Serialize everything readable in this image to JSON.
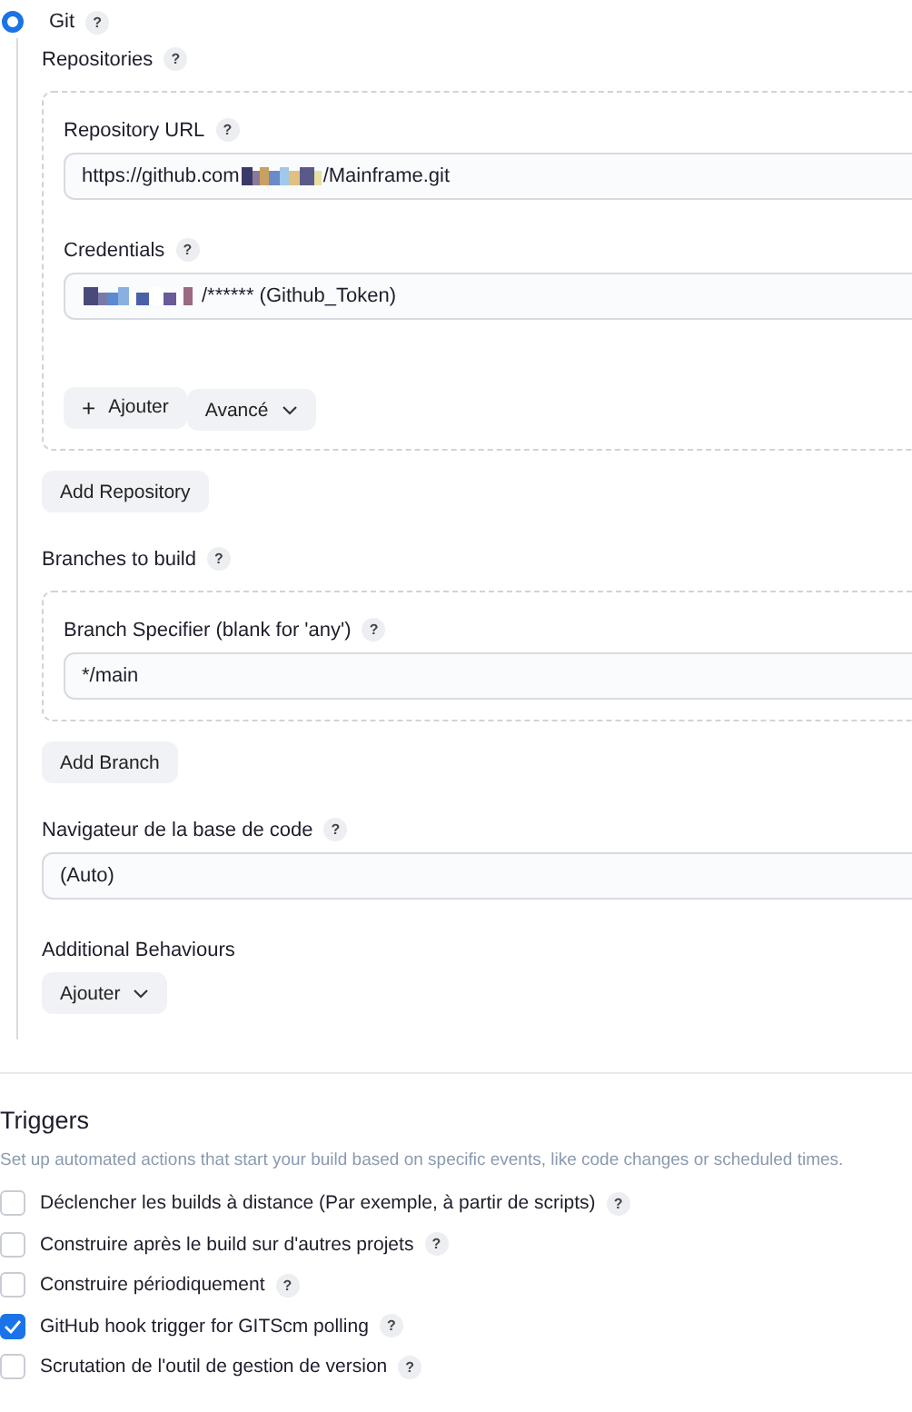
{
  "scm": {
    "label": "Git",
    "selected": true,
    "help": "?"
  },
  "repositories": {
    "label": "Repositories",
    "help": "?",
    "url": {
      "label": "Repository URL",
      "help": "?",
      "value_start": "https://github.com",
      "value_end": "/Mainframe.git"
    },
    "credentials": {
      "label": "Credentials",
      "help": "?",
      "value_end": "/****** (Github_Token)"
    },
    "add_credentials": {
      "icon": "+",
      "label": "Ajouter"
    },
    "advanced": {
      "label": "Avancé"
    },
    "add_button": "Add Repository"
  },
  "branches": {
    "label": "Branches to build",
    "help": "?",
    "specifier": {
      "label": "Branch Specifier (blank for 'any')",
      "help": "?",
      "value": "*/main"
    },
    "add_button": "Add Branch"
  },
  "browser": {
    "label": "Navigateur de la base de code",
    "help": "?",
    "value": "(Auto)"
  },
  "behaviours": {
    "label": "Additional Behaviours",
    "add_button": "Ajouter"
  },
  "triggers": {
    "title": "Triggers",
    "description": "Set up automated actions that start your build based on specific events, like code changes or scheduled times.",
    "items": [
      {
        "label": "Déclencher les builds à distance (Par exemple, à partir de scripts)",
        "checked": false,
        "help": "?"
      },
      {
        "label": "Construire après le build sur d'autres projets",
        "checked": false,
        "help": "?"
      },
      {
        "label": "Construire périodiquement",
        "checked": false,
        "help": "?"
      },
      {
        "label": "GitHub hook trigger for GITScm polling",
        "checked": true,
        "help": "?"
      },
      {
        "label": "Scrutation de l'outil de gestion de version",
        "checked": false,
        "help": "?"
      }
    ]
  }
}
